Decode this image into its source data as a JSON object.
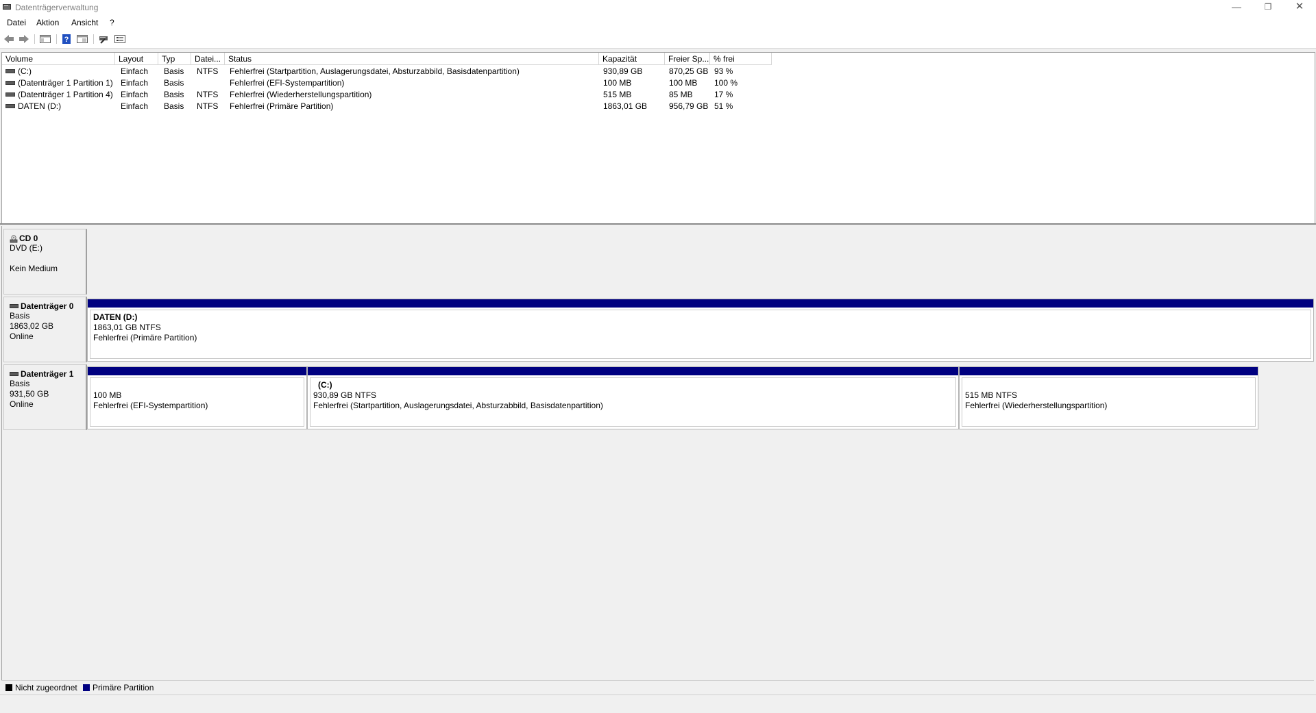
{
  "window": {
    "title": "Datenträgerverwaltung"
  },
  "menu": [
    "Datei",
    "Aktion",
    "Ansicht",
    "?"
  ],
  "toolbar": [
    "back-icon",
    "forward-icon",
    "console-icon",
    "help-icon",
    "properties-icon",
    "connect-icon",
    "settings-icon"
  ],
  "volume_table": {
    "columns": [
      "Volume",
      "Layout",
      "Typ",
      "Datei...",
      "Status",
      "Kapazität",
      "Freier Sp...",
      "% frei"
    ],
    "rows": [
      {
        "volume": "(C:)",
        "layout": "Einfach",
        "typ": "Basis",
        "datei": "NTFS",
        "status": "Fehlerfrei (Startpartition, Auslagerungsdatei, Absturzabbild, Basisdatenpartition)",
        "kapazitaet": "930,89 GB",
        "frei": "870,25 GB",
        "prozent": "93 %"
      },
      {
        "volume": "(Datenträger 1 Partition 1)",
        "layout": "Einfach",
        "typ": "Basis",
        "datei": "",
        "status": "Fehlerfrei (EFI-Systempartition)",
        "kapazitaet": "100 MB",
        "frei": "100 MB",
        "prozent": "100 %"
      },
      {
        "volume": "(Datenträger 1 Partition 4)",
        "layout": "Einfach",
        "typ": "Basis",
        "datei": "NTFS",
        "status": "Fehlerfrei (Wiederherstellungspartition)",
        "kapazitaet": "515 MB",
        "frei": "85 MB",
        "prozent": "17 %"
      },
      {
        "volume": "DATEN (D:)",
        "layout": "Einfach",
        "typ": "Basis",
        "datei": "NTFS",
        "status": "Fehlerfrei (Primäre Partition)",
        "kapazitaet": "1863,01 GB",
        "frei": "956,79 GB",
        "prozent": "51 %"
      }
    ]
  },
  "disks": {
    "cd0": {
      "name": "CD 0",
      "type": "DVD (E:)",
      "state": "Kein Medium"
    },
    "disk0": {
      "name": "Datenträger 0",
      "type": "Basis",
      "size": "1863,02 GB",
      "state": "Online",
      "partitions": [
        {
          "label": "DATEN  (D:)",
          "size": "1863,01 GB NTFS",
          "status": "Fehlerfrei (Primäre Partition)"
        }
      ]
    },
    "disk1": {
      "name": "Datenträger 1",
      "type": "Basis",
      "size": "931,50 GB",
      "state": "Online",
      "partitions": [
        {
          "label": "",
          "size": "100 MB",
          "status": "Fehlerfrei (EFI-Systempartition)"
        },
        {
          "label": "(C:)",
          "size": "930,89 GB NTFS",
          "status": "Fehlerfrei (Startpartition, Auslagerungsdatei, Absturzabbild, Basisdatenpartition)"
        },
        {
          "label": "",
          "size": "515 MB NTFS",
          "status": "Fehlerfrei (Wiederherstellungspartition)"
        }
      ]
    }
  },
  "legend": [
    {
      "label": "Nicht zugeordnet",
      "color": "#000000"
    },
    {
      "label": "Primäre Partition",
      "color": "#000080"
    }
  ]
}
